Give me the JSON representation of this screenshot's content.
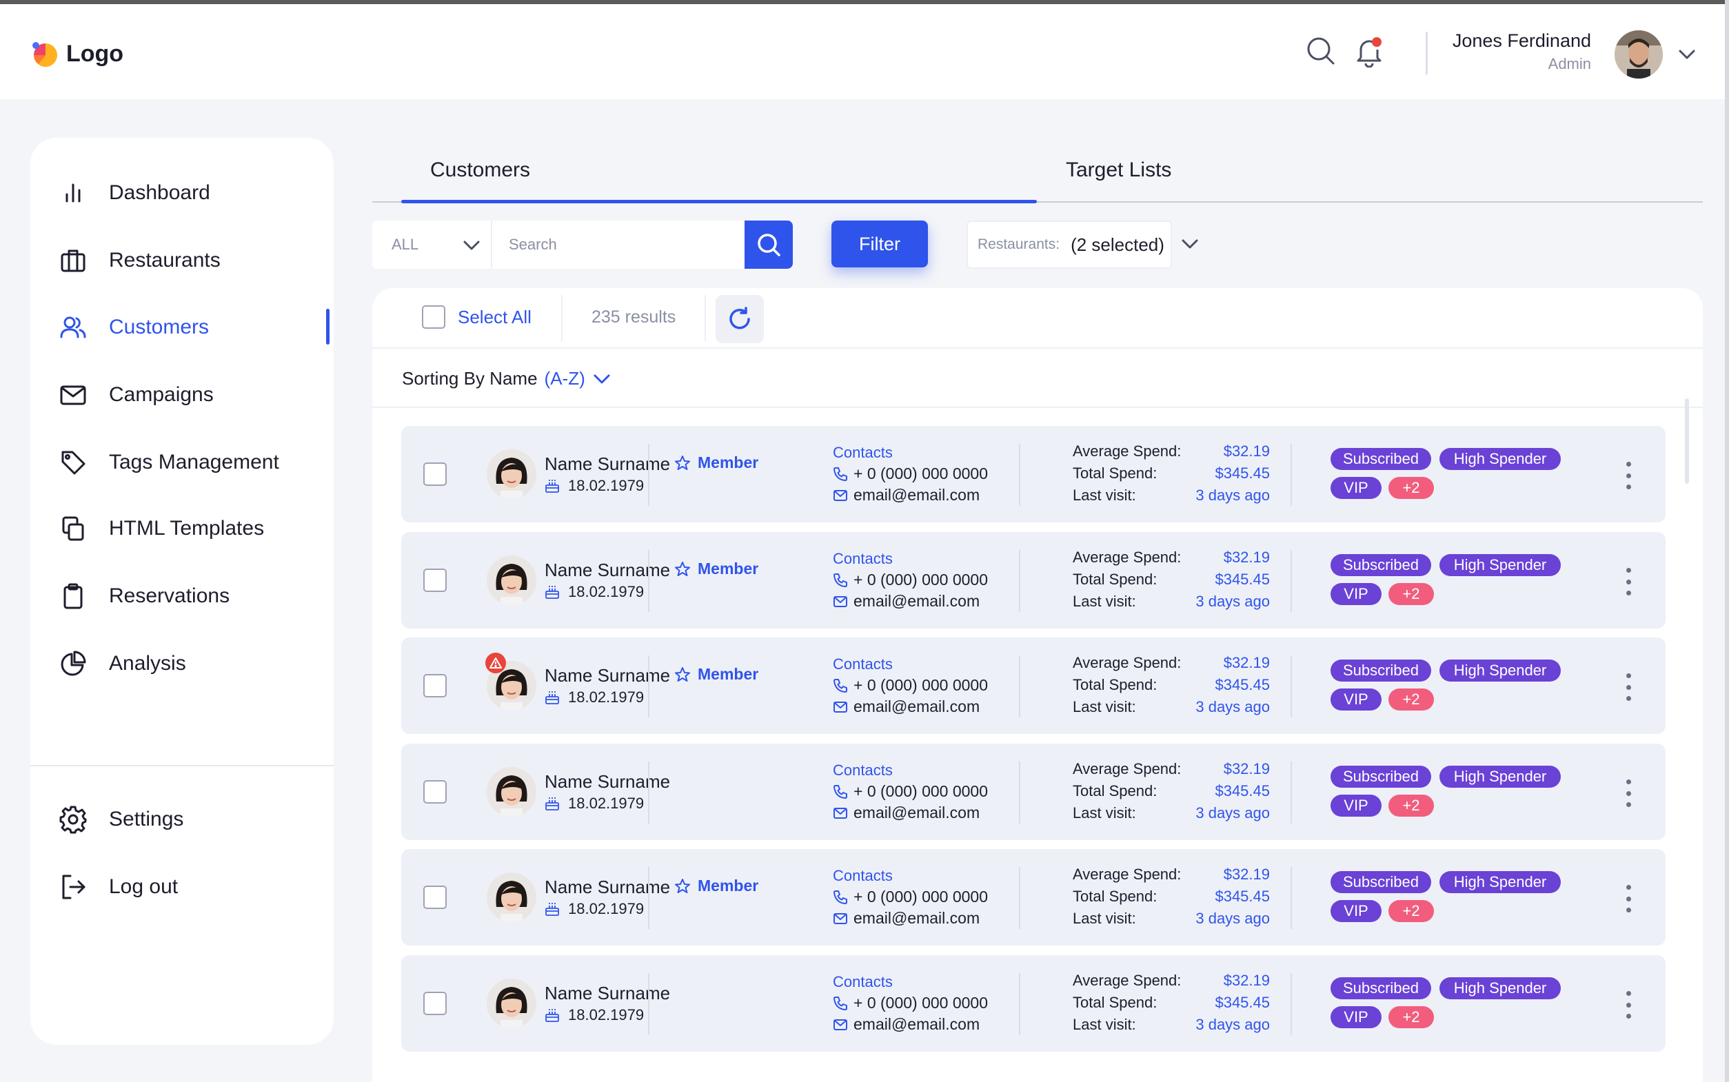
{
  "header": {
    "logo_text": "Logo",
    "user_name": "Jones Ferdinand",
    "user_role": "Admin",
    "notification_color": "#e8453c"
  },
  "sidebar": {
    "items": [
      {
        "label": "Dashboard",
        "icon": "bar-chart-icon"
      },
      {
        "label": "Restaurants",
        "icon": "briefcase-icon"
      },
      {
        "label": "Customers",
        "icon": "users-icon",
        "active": true
      },
      {
        "label": "Campaigns",
        "icon": "mail-icon"
      },
      {
        "label": "Tags Management",
        "icon": "tag-icon"
      },
      {
        "label": "HTML Templates",
        "icon": "copy-icon"
      },
      {
        "label": "Reservations",
        "icon": "clipboard-icon"
      },
      {
        "label": "Analysis",
        "icon": "pie-chart-icon"
      }
    ],
    "bottom": [
      {
        "label": "Settings",
        "icon": "gear-icon"
      },
      {
        "label": "Log out",
        "icon": "logout-icon"
      }
    ]
  },
  "tabs": [
    {
      "label": "Customers",
      "active": true
    },
    {
      "label": "Target Lists",
      "active": false
    }
  ],
  "filters": {
    "scope_value": "ALL",
    "search_placeholder": "Search",
    "filter_label": "Filter",
    "restaurants_label": "Restaurants:",
    "restaurants_value": "(2 selected)"
  },
  "toolbar": {
    "select_all_label": "Select All",
    "results_text": "235 results"
  },
  "sorting": {
    "prefix": "Sorting By Name",
    "value": "(A-Z)"
  },
  "rows": [
    {
      "name": "Name Surname",
      "member": "Member",
      "dob": "18.02.1979",
      "contacts_heading": "Contacts",
      "phone": "+ 0 (000) 000 0000",
      "email": "email@email.com",
      "avg_label": "Average Spend:",
      "avg": "$32.19",
      "total_label": "Total Spend:",
      "total": "$345.45",
      "visit_label": "Last visit:",
      "visit": "3 days ago",
      "tags": [
        "Subscribed",
        "High Spender",
        "VIP",
        "+2"
      ],
      "alert": false
    },
    {
      "name": "Name Surname",
      "member": "Member",
      "dob": "18.02.1979",
      "contacts_heading": "Contacts",
      "phone": "+ 0 (000) 000 0000",
      "email": "email@email.com",
      "avg_label": "Average Spend:",
      "avg": "$32.19",
      "total_label": "Total Spend:",
      "total": "$345.45",
      "visit_label": "Last visit:",
      "visit": "3 days ago",
      "tags": [
        "Subscribed",
        "High Spender",
        "VIP",
        "+2"
      ],
      "alert": false
    },
    {
      "name": "Name Surname",
      "member": "Member",
      "dob": "18.02.1979",
      "contacts_heading": "Contacts",
      "phone": "+ 0 (000) 000 0000",
      "email": "email@email.com",
      "avg_label": "Average Spend:",
      "avg": "$32.19",
      "total_label": "Total Spend:",
      "total": "$345.45",
      "visit_label": "Last visit:",
      "visit": "3 days ago",
      "tags": [
        "Subscribed",
        "High Spender",
        "VIP",
        "+2"
      ],
      "alert": true
    },
    {
      "name": "Name Surname",
      "member": "",
      "dob": "18.02.1979",
      "contacts_heading": "Contacts",
      "phone": "+ 0 (000) 000 0000",
      "email": "email@email.com",
      "avg_label": "Average Spend:",
      "avg": "$32.19",
      "total_label": "Total Spend:",
      "total": "$345.45",
      "visit_label": "Last visit:",
      "visit": "3 days ago",
      "tags": [
        "Subscribed",
        "High Spender",
        "VIP",
        "+2"
      ],
      "alert": false
    },
    {
      "name": "Name Surname",
      "member": "Member",
      "dob": "18.02.1979",
      "contacts_heading": "Contacts",
      "phone": "+ 0 (000) 000 0000",
      "email": "email@email.com",
      "avg_label": "Average Spend:",
      "avg": "$32.19",
      "total_label": "Total Spend:",
      "total": "$345.45",
      "visit_label": "Last visit:",
      "visit": "3 days ago",
      "tags": [
        "Subscribed",
        "High Spender",
        "VIP",
        "+2"
      ],
      "alert": false
    },
    {
      "name": "Name Surname",
      "member": "",
      "dob": "18.02.1979",
      "contacts_heading": "Contacts",
      "phone": "+ 0 (000) 000 0000",
      "email": "email@email.com",
      "avg_label": "Average Spend:",
      "avg": "$32.19",
      "total_label": "Total Spend:",
      "total": "$345.45",
      "visit_label": "Last visit:",
      "visit": "3 days ago",
      "tags": [
        "Subscribed",
        "High Spender",
        "VIP",
        "+2"
      ],
      "alert": false
    }
  ],
  "colors": {
    "accent": "#2f54eb",
    "tag_purple": "#6a42d6",
    "tag_pink": "#f25d7d"
  }
}
